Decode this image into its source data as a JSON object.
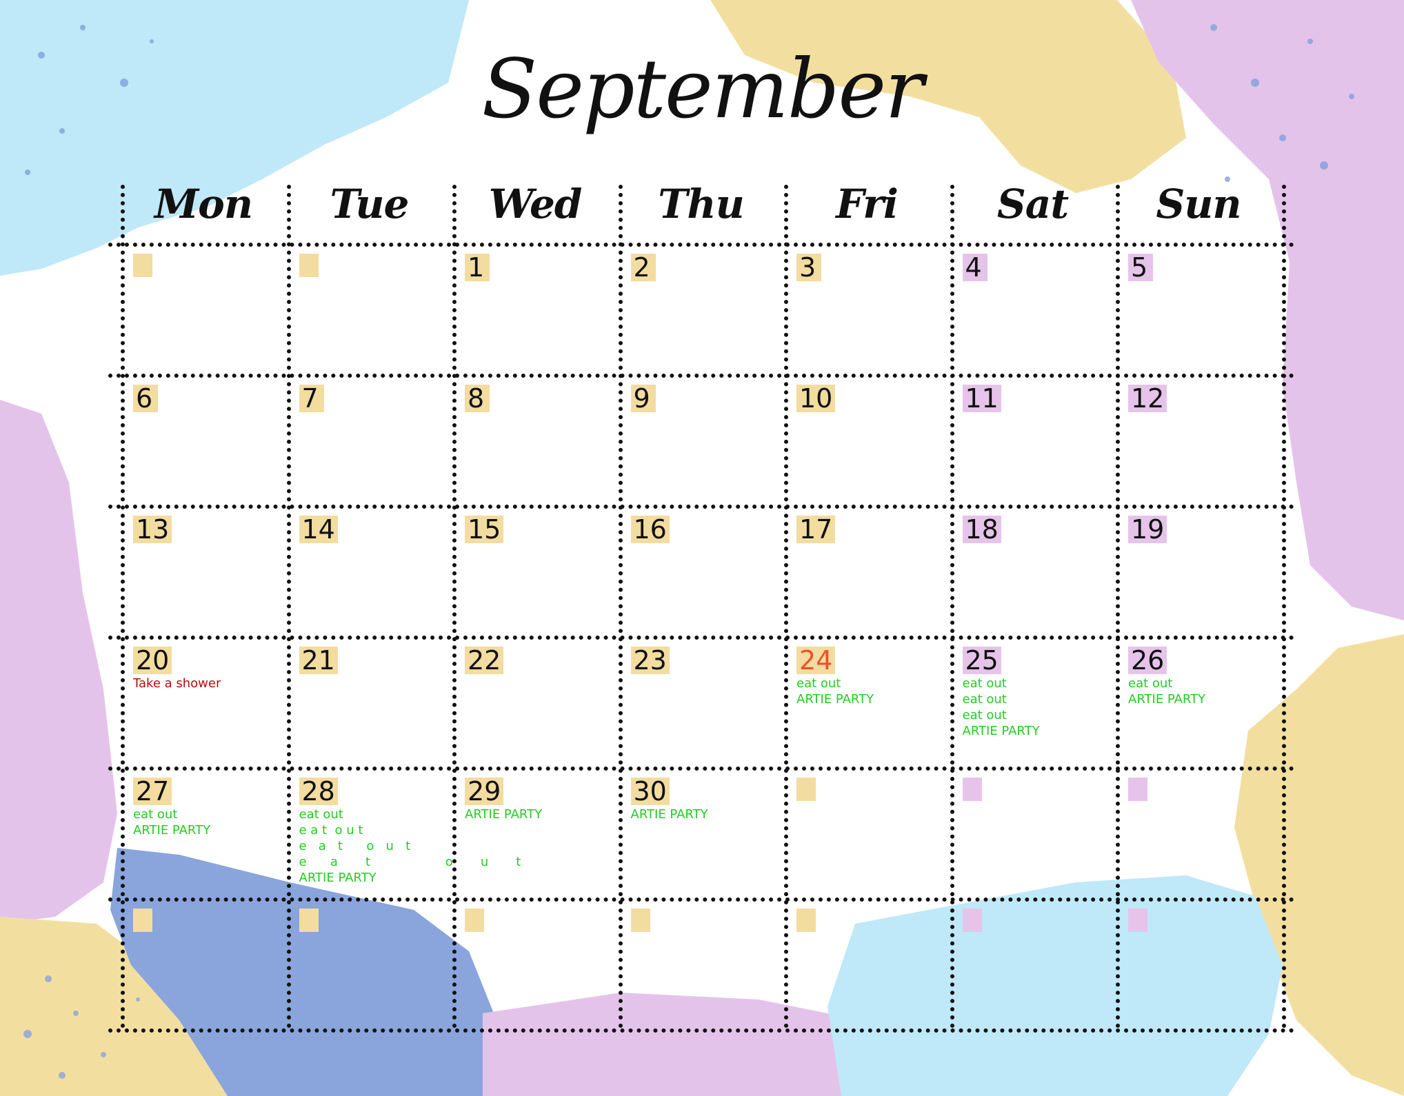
{
  "title": "September",
  "weekdays": [
    "Mon",
    "Tue",
    "Wed",
    "Thu",
    "Fri",
    "Sat",
    "Sun"
  ],
  "colors": {
    "weekday_badge": "#f2dca0",
    "weekend_badge": "#e6c4ea",
    "today_text": "#f0502a",
    "event_green": "#22cc22",
    "event_red": "#b50b0b"
  },
  "weeks": [
    [
      {
        "d": ""
      },
      {
        "d": ""
      },
      {
        "d": "1"
      },
      {
        "d": "2"
      },
      {
        "d": "3"
      },
      {
        "d": "4"
      },
      {
        "d": "5"
      }
    ],
    [
      {
        "d": "6"
      },
      {
        "d": "7"
      },
      {
        "d": "8"
      },
      {
        "d": "9"
      },
      {
        "d": "10"
      },
      {
        "d": "11"
      },
      {
        "d": "12"
      }
    ],
    [
      {
        "d": "13"
      },
      {
        "d": "14"
      },
      {
        "d": "15"
      },
      {
        "d": "16"
      },
      {
        "d": "17"
      },
      {
        "d": "18"
      },
      {
        "d": "19"
      }
    ],
    [
      {
        "d": "20",
        "events": [
          {
            "t": "Take a shower",
            "c": "red"
          }
        ]
      },
      {
        "d": "21"
      },
      {
        "d": "22"
      },
      {
        "d": "23"
      },
      {
        "d": "24",
        "today": true,
        "events": [
          {
            "t": "eat out"
          },
          {
            "t": "ARTIE PARTY"
          }
        ]
      },
      {
        "d": "25",
        "events": [
          {
            "t": "eat out"
          },
          {
            "t": "eat out"
          },
          {
            "t": "eat out"
          },
          {
            "t": "ARTIE PARTY"
          }
        ]
      },
      {
        "d": "26",
        "events": [
          {
            "t": "eat out"
          },
          {
            "t": "ARTIE PARTY"
          }
        ]
      }
    ],
    [
      {
        "d": "27",
        "events": [
          {
            "t": "eat out"
          },
          {
            "t": "ARTIE PARTY"
          }
        ]
      },
      {
        "d": "28",
        "events": [
          {
            "t": "eat out"
          },
          {
            "t": "e a t  o u t"
          },
          {
            "t": "e   a   t      o   u   t"
          },
          {
            "t": "e      a       t                   o       u       t"
          },
          {
            "t": "ARTIE PARTY"
          }
        ]
      },
      {
        "d": "29",
        "events": [
          {
            "t": "ARTIE PARTY"
          }
        ]
      },
      {
        "d": "30",
        "events": [
          {
            "t": "ARTIE PARTY"
          }
        ]
      },
      {
        "d": ""
      },
      {
        "d": ""
      },
      {
        "d": ""
      }
    ],
    [
      {
        "d": ""
      },
      {
        "d": ""
      },
      {
        "d": ""
      },
      {
        "d": ""
      },
      {
        "d": ""
      },
      {
        "d": ""
      },
      {
        "d": ""
      }
    ]
  ]
}
